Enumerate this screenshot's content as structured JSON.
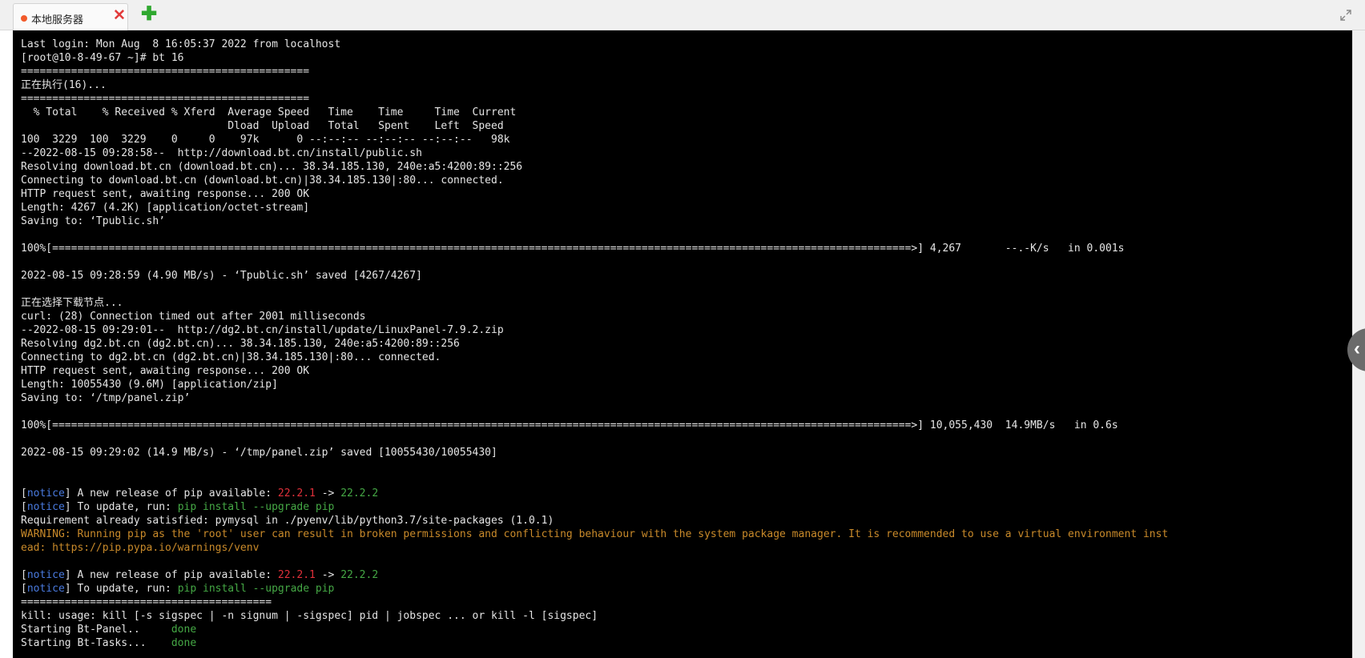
{
  "tabs": [
    {
      "label": "本地服务器",
      "status_color": "#f25a2a"
    }
  ],
  "icons": {
    "close": "close-icon",
    "add": "plus-icon",
    "expand": "expand-icon",
    "side_panel": "chevron-left-icon"
  },
  "colors": {
    "background": "#000000",
    "text": "#e5e5e5",
    "notice": "#4a7be0",
    "old_version": "#e0303a",
    "new_version": "#45a845",
    "warning": "#c98a2a",
    "tab_close": "#e23b3b",
    "tab_add": "#2fa82f"
  },
  "terminal": {
    "lines": [
      [
        {
          "t": "Last login: Mon Aug  8 16:05:37 2022 from localhost"
        }
      ],
      [
        {
          "t": "[root@10-8-49-67 ~]# bt 16"
        }
      ],
      [
        {
          "t": "=============================================="
        }
      ],
      [
        {
          "t": "正在执行(16)..."
        }
      ],
      [
        {
          "t": "=============================================="
        }
      ],
      [
        {
          "t": "  % Total    % Received % Xferd  Average Speed   Time    Time     Time  Current"
        }
      ],
      [
        {
          "t": "                                 Dload  Upload   Total   Spent    Left  Speed"
        }
      ],
      [
        {
          "t": "100  3229  100  3229    0     0    97k      0 --:--:-- --:--:-- --:--:--   98k"
        }
      ],
      [
        {
          "t": "--2022-08-15 09:28:58--  http://download.bt.cn/install/public.sh"
        }
      ],
      [
        {
          "t": "Resolving download.bt.cn (download.bt.cn)... 38.34.185.130, 240e:a5:4200:89::256"
        }
      ],
      [
        {
          "t": "Connecting to download.bt.cn (download.bt.cn)|38.34.185.130|:80... connected."
        }
      ],
      [
        {
          "t": "HTTP request sent, awaiting response... 200 OK"
        }
      ],
      [
        {
          "t": "Length: 4267 (4.2K) [application/octet-stream]"
        }
      ],
      [
        {
          "t": "Saving to: ‘Tpublic.sh’"
        }
      ],
      [],
      [
        {
          "t": "100%[=========================================================================================================================================>] 4,267       --.-K/s   in 0.001s"
        }
      ],
      [],
      [
        {
          "t": "2022-08-15 09:28:59 (4.90 MB/s) - ‘Tpublic.sh’ saved [4267/4267]"
        }
      ],
      [],
      [
        {
          "t": "正在选择下载节点..."
        }
      ],
      [
        {
          "t": "curl: (28) Connection timed out after 2001 milliseconds"
        }
      ],
      [
        {
          "t": "--2022-08-15 09:29:01--  http://dg2.bt.cn/install/update/LinuxPanel-7.9.2.zip"
        }
      ],
      [
        {
          "t": "Resolving dg2.bt.cn (dg2.bt.cn)... 38.34.185.130, 240e:a5:4200:89::256"
        }
      ],
      [
        {
          "t": "Connecting to dg2.bt.cn (dg2.bt.cn)|38.34.185.130|:80... connected."
        }
      ],
      [
        {
          "t": "HTTP request sent, awaiting response... 200 OK"
        }
      ],
      [
        {
          "t": "Length: 10055430 (9.6M) [application/zip]"
        }
      ],
      [
        {
          "t": "Saving to: ‘/tmp/panel.zip’"
        }
      ],
      [],
      [
        {
          "t": "100%[=========================================================================================================================================>] 10,055,430  14.9MB/s   in 0.6s"
        }
      ],
      [],
      [
        {
          "t": "2022-08-15 09:29:02 (14.9 MB/s) - ‘/tmp/panel.zip’ saved [10055430/10055430]"
        }
      ],
      [],
      [],
      [
        {
          "t": "["
        },
        {
          "t": "notice",
          "c": "blue"
        },
        {
          "t": "] A new release of pip available: "
        },
        {
          "t": "22.2.1",
          "c": "red"
        },
        {
          "t": " -> "
        },
        {
          "t": "22.2.2",
          "c": "green"
        }
      ],
      [
        {
          "t": "["
        },
        {
          "t": "notice",
          "c": "blue"
        },
        {
          "t": "] To update, run: "
        },
        {
          "t": "pip install --upgrade pip",
          "c": "green"
        }
      ],
      [
        {
          "t": "Requirement already satisfied: pymysql in ./pyenv/lib/python3.7/site-packages (1.0.1)"
        }
      ],
      [
        {
          "t": "WARNING: Running pip as the 'root' user can result in broken permissions and conflicting behaviour with the system package manager. It is recommended to use a virtual environment inst",
          "c": "orange"
        }
      ],
      [
        {
          "t": "ead: https://pip.pypa.io/warnings/venv",
          "c": "orange"
        }
      ],
      [],
      [
        {
          "t": "["
        },
        {
          "t": "notice",
          "c": "blue"
        },
        {
          "t": "] A new release of pip available: "
        },
        {
          "t": "22.2.1",
          "c": "red"
        },
        {
          "t": " -> "
        },
        {
          "t": "22.2.2",
          "c": "green"
        }
      ],
      [
        {
          "t": "["
        },
        {
          "t": "notice",
          "c": "blue"
        },
        {
          "t": "] To update, run: "
        },
        {
          "t": "pip install --upgrade pip",
          "c": "green"
        }
      ],
      [
        {
          "t": "========================================"
        }
      ],
      [
        {
          "t": "kill: usage: kill [-s sigspec | -n signum | -sigspec] pid | jobspec ... or kill -l [sigspec]"
        }
      ],
      [
        {
          "t": "Starting Bt-Panel..     "
        },
        {
          "t": "done",
          "c": "green"
        }
      ],
      [
        {
          "t": "Starting Bt-Tasks...    "
        },
        {
          "t": "done",
          "c": "green"
        }
      ]
    ]
  }
}
